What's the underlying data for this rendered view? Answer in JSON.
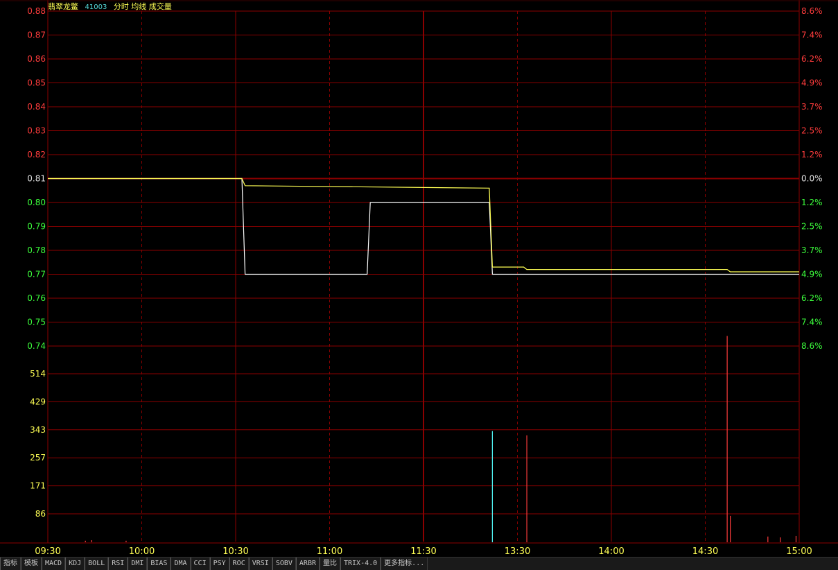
{
  "header": {
    "name": "翡翠龙鳖",
    "code": "41003",
    "mode": "分时 均线 成交量"
  },
  "colors": {
    "up": "#ff3c3c",
    "down": "#3cff3c",
    "flat": "#e0e0e0",
    "price_line": "#ffffff",
    "avg_line": "#ffff54",
    "grid": "#8b0000",
    "axis_text": "#ffff54",
    "volume_down": "#54ffff",
    "volume_up": "#ff3c3c"
  },
  "chart_data": {
    "type": "line",
    "prev_close": 0.81,
    "price_ticks": [
      "0.88",
      "0.87",
      "0.86",
      "0.85",
      "0.84",
      "0.83",
      "0.82",
      "0.81",
      "0.80",
      "0.79",
      "0.78",
      "0.77",
      "0.76",
      "0.75",
      "0.74"
    ],
    "pct_ticks": [
      "8.6%",
      "7.4%",
      "6.2%",
      "4.9%",
      "3.7%",
      "2.5%",
      "1.2%",
      "0.0%",
      "1.2%",
      "2.5%",
      "3.7%",
      "4.9%",
      "6.2%",
      "7.4%",
      "8.6%"
    ],
    "price_range": [
      0.74,
      0.88
    ],
    "volume_ticks": [
      "514",
      "429",
      "343",
      "257",
      "171",
      "86"
    ],
    "volume_range": [
      0,
      600
    ],
    "time_ticks": [
      "09:30",
      "10:00",
      "10:30",
      "11:00",
      "11:30",
      "13:30",
      "14:00",
      "14:30",
      "15:00"
    ],
    "session_minutes": 240,
    "series": [
      {
        "key": "price",
        "x": [
          0,
          62,
          63,
          102,
          103,
          106,
          107,
          141,
          142,
          240
        ],
        "y": [
          0.81,
          0.81,
          0.77,
          0.77,
          0.8,
          0.8,
          0.8,
          0.8,
          0.77,
          0.77
        ]
      },
      {
        "key": "avg",
        "x": [
          0,
          62,
          63,
          141,
          142,
          152,
          153,
          217,
          218,
          240
        ],
        "y": [
          0.81,
          0.81,
          0.807,
          0.806,
          0.773,
          0.773,
          0.772,
          0.772,
          0.771,
          0.771
        ]
      }
    ],
    "volume": [
      {
        "t": 12,
        "v": 3,
        "dir": "up"
      },
      {
        "t": 14,
        "v": 5,
        "dir": "up"
      },
      {
        "t": 25,
        "v": 3,
        "dir": "up"
      },
      {
        "t": 142,
        "v": 395,
        "dir": "down"
      },
      {
        "t": 153,
        "v": 380,
        "dir": "up"
      },
      {
        "t": 217,
        "v": 735,
        "dir": "up"
      },
      {
        "t": 218,
        "v": 92,
        "dir": "up"
      },
      {
        "t": 230,
        "v": 18,
        "dir": "up"
      },
      {
        "t": 234,
        "v": 15,
        "dir": "up"
      },
      {
        "t": 239,
        "v": 20,
        "dir": "up"
      }
    ]
  },
  "tabs": [
    "指标",
    "模板",
    "MACD",
    "KDJ",
    "BOLL",
    "RSI",
    "DMI",
    "BIAS",
    "DMA",
    "CCI",
    "PSY",
    "ROC",
    "VRSI",
    "SOBV",
    "ARBR",
    "量比",
    "TRIX-4.0",
    "更多指标..."
  ]
}
